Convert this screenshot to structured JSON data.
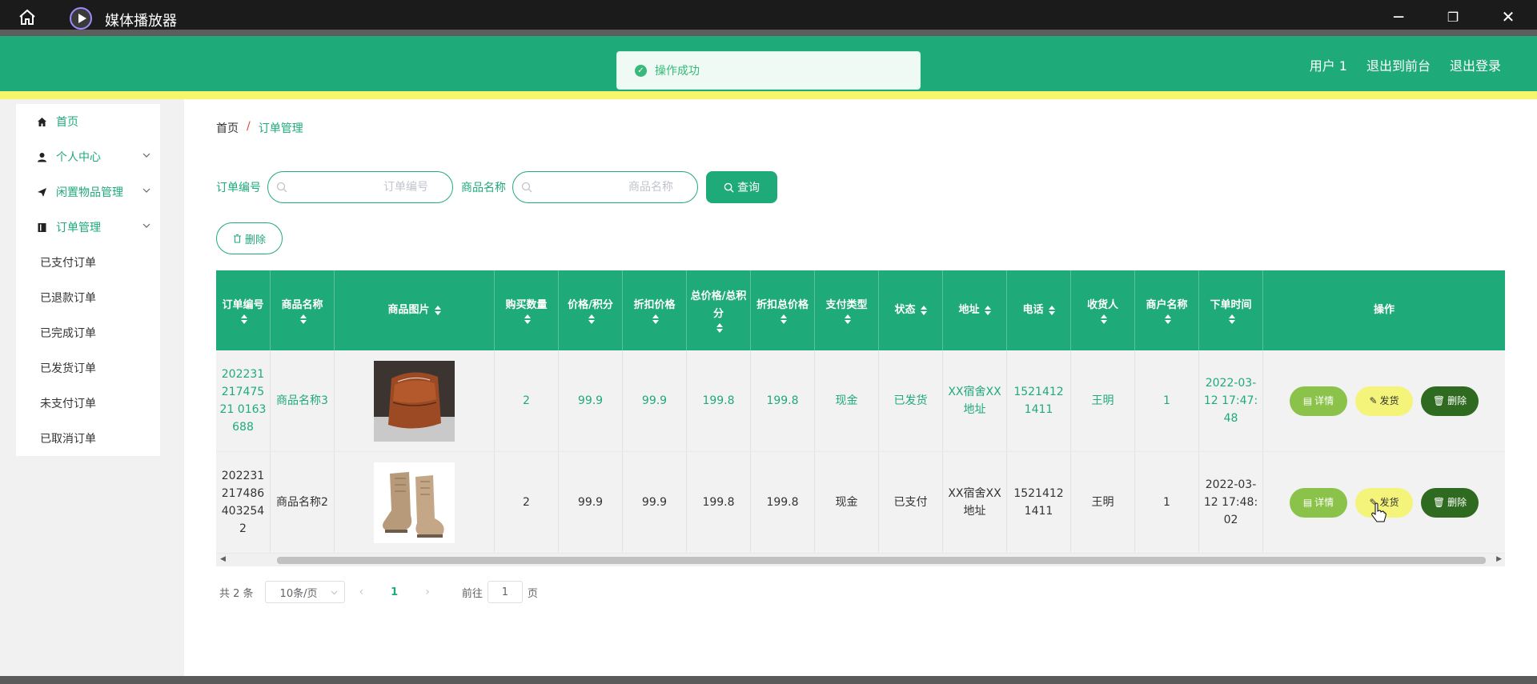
{
  "titlebar": {
    "title": "媒体播放器",
    "home_icon": "home-icon",
    "minimize": "─",
    "maximize": "❐",
    "close": "✕"
  },
  "header": {
    "user": "用户 1",
    "to_front": "退出到前台",
    "logout": "退出登录",
    "accent": "#1faa7a"
  },
  "toast": {
    "message": "操作成功"
  },
  "sidebar": {
    "items": [
      {
        "label": "首页",
        "icon": "house-icon"
      },
      {
        "label": "个人中心",
        "icon": "person-icon"
      },
      {
        "label": "闲置物品管理",
        "icon": "paper-plane-icon"
      },
      {
        "label": "订单管理",
        "icon": "book-icon"
      }
    ],
    "sub_items": [
      "已支付订单",
      "已退款订单",
      "已完成订单",
      "已发货订单",
      "未支付订单",
      "已取消订单"
    ]
  },
  "breadcrumb": {
    "home": "首页",
    "sep": "/",
    "current": "订单管理"
  },
  "search": {
    "order_label": "订单编号",
    "order_placeholder": "订单编号",
    "product_label": "商品名称",
    "product_placeholder": "商品名称",
    "query_button": "查询",
    "delete_button": "删除"
  },
  "table": {
    "headers": [
      "订单编号",
      "商品名称",
      "商品图片",
      "购买数量",
      "价格/积分",
      "折扣价格",
      "总价格/总积分",
      "折扣总价格",
      "支付类型",
      "状态",
      "地址",
      "电话",
      "收货人",
      "商户名称",
      "下单时间",
      "操作"
    ],
    "rows": [
      {
        "order_no": "20223121747521 0163688",
        "product": "商品名称3",
        "image": "brown-leather-bag",
        "qty": "2",
        "price": "99.9",
        "discount": "99.9",
        "total": "199.8",
        "discount_total": "199.8",
        "pay_type": "现金",
        "status": "已发货",
        "address": "XX宿舍XX地址",
        "phone": "15214121411",
        "receiver": "王明",
        "merchant": "1",
        "time": "2022-03-12 17:47:48"
      },
      {
        "order_no": "2022312174864032542",
        "product": "商品名称2",
        "image": "tan-boots",
        "qty": "2",
        "price": "99.9",
        "discount": "99.9",
        "total": "199.8",
        "discount_total": "199.8",
        "pay_type": "现金",
        "status": "已支付",
        "address": "XX宿舍XX地址",
        "phone": "15214121411",
        "receiver": "王明",
        "merchant": "1",
        "time": "2022-03-12 17:48:02"
      }
    ],
    "actions": {
      "detail": "详情",
      "ship": "发货",
      "delete": "删除"
    }
  },
  "pager": {
    "total": "共 2 条",
    "page_size": "10条/页",
    "current_page": "1",
    "goto_label": "前往",
    "goto_value": "1",
    "page_suffix": "页"
  }
}
